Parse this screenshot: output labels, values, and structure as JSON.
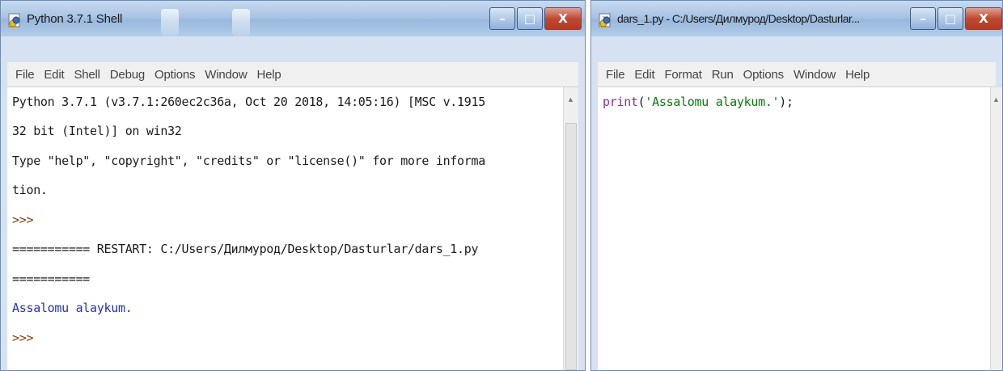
{
  "shell": {
    "title": "Python 3.7.1 Shell",
    "menu": [
      "File",
      "Edit",
      "Shell",
      "Debug",
      "Options",
      "Window",
      "Help"
    ],
    "lines": [
      {
        "text": "Python 3.7.1 (v3.7.1:260ec2c36a, Oct 20 2018, 14:05:16) [MSC v.1915",
        "kind": "normal"
      },
      {
        "text": "32 bit (Intel)] on win32",
        "kind": "normal"
      },
      {
        "text": "Type \"help\", \"copyright\", \"credits\" or \"license()\" for more informa",
        "kind": "normal"
      },
      {
        "text": "tion.",
        "kind": "normal"
      },
      {
        "text": ">>>",
        "kind": "prompt"
      },
      {
        "text": "=========== RESTART: C:/Users/Дилмурод/Desktop/Dasturlar/dars_1.py",
        "kind": "normal"
      },
      {
        "text": "===========",
        "kind": "normal"
      },
      {
        "text": "Assalomu alaykum.",
        "kind": "output"
      },
      {
        "text": ">>>",
        "kind": "prompt"
      }
    ]
  },
  "editor": {
    "title": "dars_1.py - C:/Users/Дилмурод/Desktop/Dasturlar...",
    "menu": [
      "File",
      "Edit",
      "Format",
      "Run",
      "Options",
      "Window",
      "Help"
    ],
    "code": {
      "func": "print",
      "open": "(",
      "string": "'Assalomu alaykum.'",
      "close": ");"
    }
  },
  "window_controls": {
    "minimize": "–",
    "maximize": "□",
    "close": "X"
  },
  "colors": {
    "prompt": "#8a3b00",
    "output": "#1f2fc8",
    "string": "#008000",
    "builtin": "#8d2fa6",
    "title_bar": "#a9c4e4"
  },
  "icons": {
    "app": "python-idle-icon",
    "scroll_up": "scroll-up-arrow-icon"
  }
}
